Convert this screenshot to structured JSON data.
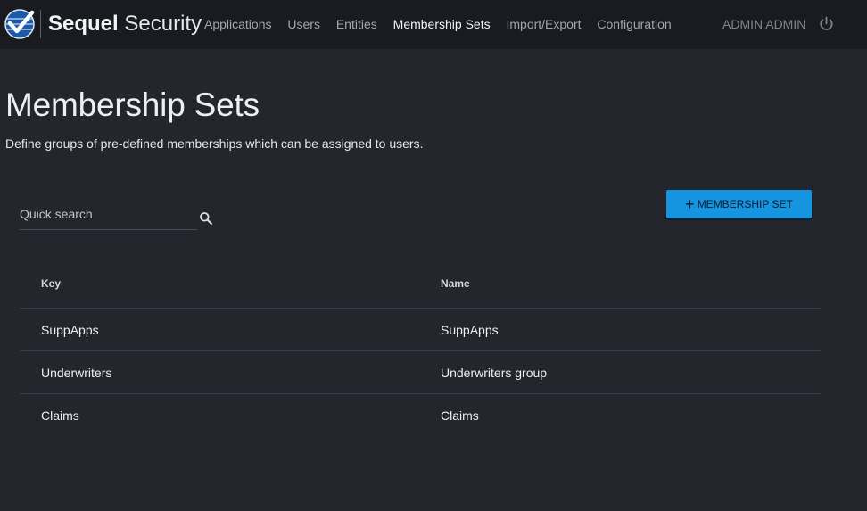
{
  "header": {
    "brand_bold": "Sequel",
    "brand_light": "Security",
    "nav": [
      {
        "label": "Applications",
        "active": false
      },
      {
        "label": "Users",
        "active": false
      },
      {
        "label": "Entities",
        "active": false
      },
      {
        "label": "Membership Sets",
        "active": true
      },
      {
        "label": "Import/Export",
        "active": false
      },
      {
        "label": "Configuration",
        "active": false
      }
    ],
    "user_name": "ADMIN ADMIN",
    "power_icon": "power-icon",
    "logo_icon": "checkmark-globe-logo"
  },
  "page": {
    "title": "Membership Sets",
    "description": "Define groups of pre-defined memberships which can be assigned to users."
  },
  "toolbar": {
    "search_placeholder": "Quick search",
    "search_value": "",
    "search_icon": "search-icon",
    "add_button_label": "MEMBERSHIP SET",
    "add_button_icon": "plus-icon"
  },
  "table": {
    "columns": [
      "Key",
      "Name"
    ],
    "rows": [
      {
        "key": "SuppApps",
        "name": "SuppApps"
      },
      {
        "key": "Underwriters",
        "name": "Underwriters group"
      },
      {
        "key": "Claims",
        "name": "Claims"
      }
    ]
  },
  "colors": {
    "background": "#23262d",
    "topbar": "#191b20",
    "accent": "#1594e0"
  }
}
